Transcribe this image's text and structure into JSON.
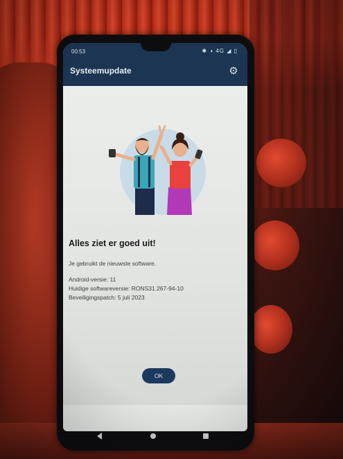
{
  "status_bar": {
    "time": "00:53",
    "icons": "✱ ◑ 4G ◢ ▯"
  },
  "app_bar": {
    "title": "Systeemupdate",
    "settings_icon": "gear-icon"
  },
  "content": {
    "heading": "Alles ziet er goed uit!",
    "message": "Je gebruikt de nieuwste software.",
    "android_version": "Android-versie: 11",
    "software_version": "Huidige softwareversie: RONS31.267-94-10",
    "security_patch": "Beveiligingspatch: 5 juli 2023"
  },
  "ok_label": "OK",
  "colors": {
    "app_bar": "#1b3553",
    "ok_button": "#1b3a5e",
    "screen_bg": "#e6e8e6"
  }
}
